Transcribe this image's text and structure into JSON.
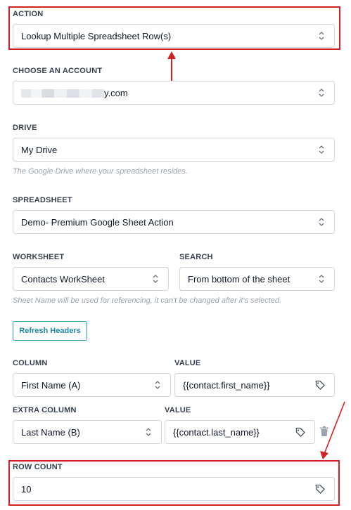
{
  "action": {
    "label": "ACTION",
    "value": "Lookup Multiple Spreadsheet Row(s)"
  },
  "account": {
    "label": "CHOOSE AN ACCOUNT",
    "value_suffix": "y.com"
  },
  "drive": {
    "label": "DRIVE",
    "value": "My Drive",
    "help": "The Google Drive where your spreadsheet resides."
  },
  "spreadsheet": {
    "label": "SPREADSHEET",
    "value": "Demo- Premium Google Sheet Action"
  },
  "worksheet": {
    "label": "WORKSHEET",
    "value": "Contacts WorkSheet"
  },
  "search": {
    "label": "SEARCH",
    "value": "From bottom of the sheet"
  },
  "worksheet_help": "Sheet Name will be used for referencing, it can't be changed after it's selected.",
  "refresh_button": "Refresh Headers",
  "column": {
    "label": "COLUMN",
    "value": "First Name (A)"
  },
  "value1": {
    "label": "VALUE",
    "value": "{{contact.first_name}}"
  },
  "extra_column": {
    "label": "EXTRA COLUMN",
    "value": "Last Name (B)"
  },
  "value2": {
    "label": "VALUE",
    "value": "{{contact.last_name}}"
  },
  "row_count": {
    "label": "ROW COUNT",
    "value": "10"
  },
  "colors": {
    "annotation": "#d32020",
    "button": "#2b9bb5"
  },
  "icons": [
    "chevron-up-down-icon",
    "tag-icon",
    "trash-icon",
    "arrow-annotation"
  ]
}
